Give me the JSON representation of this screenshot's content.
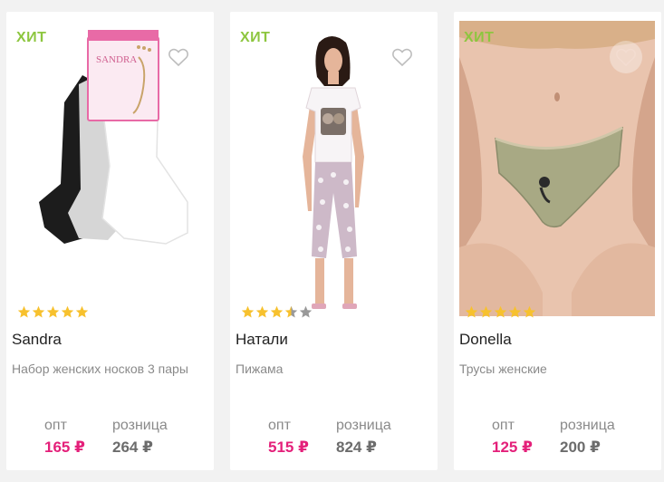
{
  "colors": {
    "badge": "#8dc63f",
    "opt_price": "#e4207a",
    "retail_price": "#6c6c6c",
    "star_filled": "#f7c12e",
    "star_empty": "#999999"
  },
  "products": [
    {
      "badge": "ХИТ",
      "name": "Sandra",
      "description": "Набор женских носков 3 пары",
      "rating": 5,
      "opt_label": "опт",
      "opt_price": "165 ₽",
      "retail_label": "розница",
      "retail_price": "264 ₽",
      "package_text": "SANDRA"
    },
    {
      "badge": "ХИТ",
      "name": "Натали",
      "description": "Пижама",
      "rating": 3.5,
      "opt_label": "опт",
      "opt_price": "515 ₽",
      "retail_label": "розница",
      "retail_price": "824 ₽"
    },
    {
      "badge": "ХИТ",
      "name": "Donella",
      "description": "Трусы женские",
      "rating": 5,
      "opt_label": "опт",
      "opt_price": "125 ₽",
      "retail_label": "розница",
      "retail_price": "200 ₽"
    }
  ]
}
